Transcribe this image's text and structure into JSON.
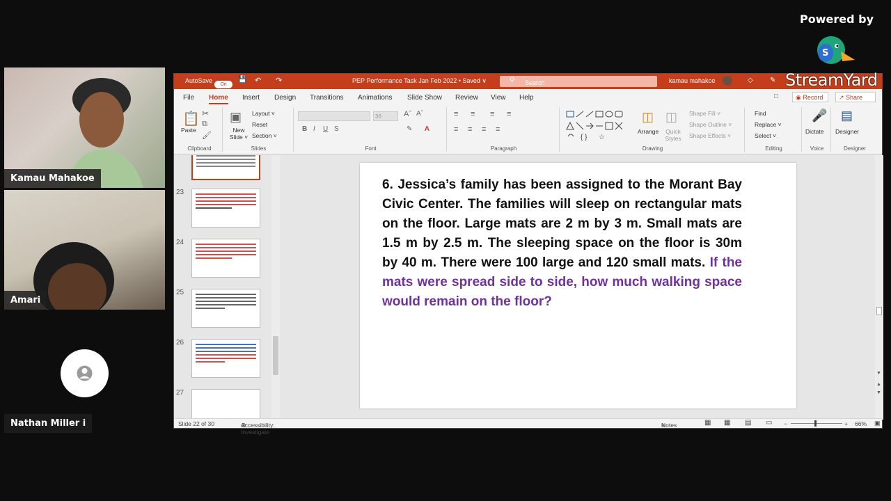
{
  "branding": {
    "powered_by": "Powered by",
    "logo_text": "StreamYard"
  },
  "participants": [
    {
      "name": "Kamau Mahakoe"
    },
    {
      "name": "Amari"
    },
    {
      "name": "Nathan Miller i"
    }
  ],
  "ppt": {
    "autosave_label": "AutoSave",
    "autosave_state": "On",
    "doc_title": "PEP Performance Task Jan Feb 2022 • Saved ∨",
    "search_placeholder": "Search",
    "user_name": "kamau mahakoe",
    "menu_tabs": [
      "File",
      "Home",
      "Insert",
      "Design",
      "Transitions",
      "Animations",
      "Slide Show",
      "Review",
      "View",
      "Help"
    ],
    "record_label": "Record",
    "share_label": "Share",
    "ribbon": {
      "paste": "Paste",
      "new_slide": "New Slide ˅",
      "layout": "Layout ˅",
      "reset": "Reset",
      "section": "Section ˅",
      "font_size": "36",
      "arrange": "Arrange",
      "quick_styles": "Quick Styles",
      "shape_fill": "Shape Fill ˅",
      "shape_outline": "Shape Outline ˅",
      "shape_effects": "Shape Effects ˅",
      "find": "Find",
      "replace": "Replace ˅",
      "select": "Select ˅",
      "dictate": "Dictate",
      "designer": "Designer",
      "groups": [
        "Clipboard",
        "Slides",
        "Font",
        "Paragraph",
        "Drawing",
        "Editing",
        "Voice",
        "Designer"
      ]
    },
    "thumb_numbers": [
      "23",
      "24",
      "25",
      "26",
      "27"
    ],
    "slide_text_main": "6.  Jessica’s family has been assigned to the Morant Bay Civic Center. The families will sleep on rectangular mats on the floor. Large mats are 2 m by 3 m. Small mats are 1.5 m by 2.5 m. The sleeping space on the floor is 30m by 40 m. There were 100 large and 120 small mats.",
    "slide_text_question": "If the mats were spread side to side, how much walking space would remain on the floor?",
    "status": {
      "slide_info": "Slide 22 of 30",
      "accessibility": "Accessibility: Investigate",
      "notes": "Notes",
      "zoom": "66%"
    }
  },
  "colors": {
    "ppt_accent": "#c43e1c",
    "question_purple": "#7030a0"
  }
}
